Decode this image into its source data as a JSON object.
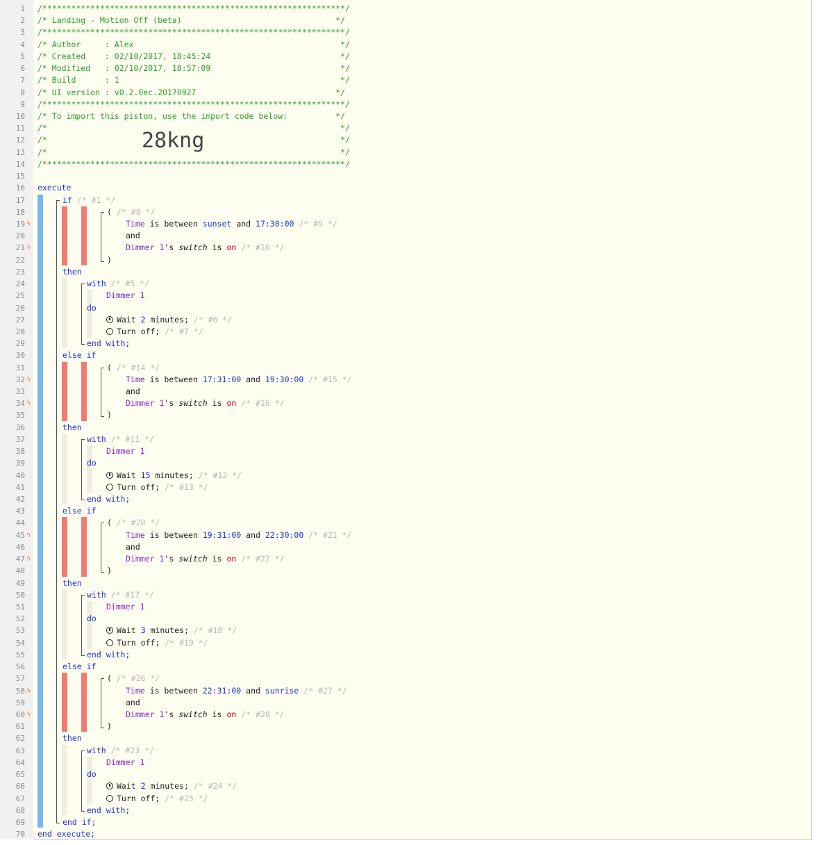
{
  "header": {
    "border": "/***************************************************************/",
    "title_line": "/* Landing - Motion Off (beta)                                */",
    "author_line": "/* Author     : Alex                                           */",
    "created_line": "/* Created    : 02/10/2017, 18:45:24                           */",
    "modified_line": "/* Modified   : 02/10/2017, 18:57:09                           */",
    "build_line": "/* Build      : 1                                              */",
    "ui_version_line": "/* UI version : v0.2.0ec.20170927                             */",
    "import_line": "/* To import this piston, use the import code below:          */",
    "blank_line": "/*                                                             */",
    "import_code": "28kng"
  },
  "keywords": {
    "execute": "execute",
    "if": "if",
    "then": "then",
    "else_if": "else if",
    "with": "with",
    "do": "do",
    "end_with": "end with;",
    "end_if": "end if;",
    "end_execute": "end execute;",
    "and": "and",
    "is_between": "is between",
    "open_paren": "(",
    "close_paren": ")"
  },
  "statements": {
    "if_id": "/* #1 */",
    "blocks": [
      {
        "group_id": "/* #8 */",
        "subject": "Time",
        "from": "sunset",
        "to": "17:30:00",
        "cond1_id": "/* #9 */",
        "device": "Dimmer 1",
        "attr_suffix": "'s",
        "attribute": "switch",
        "op": "is",
        "value": "on",
        "cond2_id": "/* #10 */",
        "with_id": "/* #5 */",
        "wait_amount": "2",
        "wait_unit": "minutes;",
        "wait_id": "/* #6 */",
        "action": "Turn off;",
        "action_id": "/* #7 */"
      },
      {
        "group_id": "/* #14 */",
        "subject": "Time",
        "from": "17:31:00",
        "to": "19:30:00",
        "cond1_id": "/* #15 */",
        "device": "Dimmer 1",
        "attr_suffix": "'s",
        "attribute": "switch",
        "op": "is",
        "value": "on",
        "cond2_id": "/* #16 */",
        "with_id": "/* #11 */",
        "wait_amount": "15",
        "wait_unit": "minutes;",
        "wait_id": "/* #12 */",
        "action": "Turn off;",
        "action_id": "/* #13 */"
      },
      {
        "group_id": "/* #20 */",
        "subject": "Time",
        "from": "19:31:00",
        "to": "22:30:00",
        "cond1_id": "/* #21 */",
        "device": "Dimmer 1",
        "attr_suffix": "'s",
        "attribute": "switch",
        "op": "is",
        "value": "on",
        "cond2_id": "/* #22 */",
        "with_id": "/* #17 */",
        "wait_amount": "3",
        "wait_unit": "minutes;",
        "wait_id": "/* #18 */",
        "action": "Turn off;",
        "action_id": "/* #19 */"
      },
      {
        "group_id": "/* #26 */",
        "subject": "Time",
        "from": "22:31:00",
        "to": "sunrise",
        "cond1_id": "/* #27 */",
        "device": "Dimmer 1",
        "attr_suffix": "'s",
        "attribute": "switch",
        "op": "is",
        "value": "on",
        "cond2_id": "/* #28 */",
        "with_id": "/* #23 */",
        "wait_amount": "2",
        "wait_unit": "minutes;",
        "wait_id": "/* #24 */",
        "action": "Turn off;",
        "action_id": "/* #25 */"
      }
    ]
  },
  "wait_label": "Wait",
  "icons": {
    "wait": "stopwatch-icon",
    "action": "power-icon",
    "trigger": "lightning-bolt-icon"
  },
  "colors": {
    "comment": "#2ca02c",
    "keyword": "#1f34d8",
    "device": "#8a2ac7",
    "execute_bar": "#76b8ee",
    "condition_bar": "#f07b73",
    "trigger": "#ef7f31"
  }
}
